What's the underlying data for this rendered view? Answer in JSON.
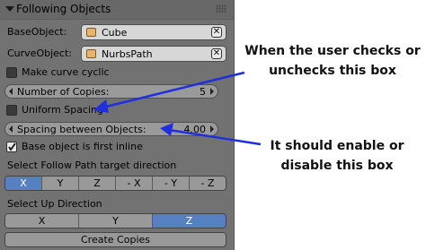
{
  "panel": {
    "title": "Following Objects",
    "base_object": {
      "label": "BaseObject:",
      "value": "Cube"
    },
    "curve_object": {
      "label": "CurveObject:",
      "value": "NurbsPath"
    },
    "make_curve_cyclic": {
      "label": "Make curve cyclic",
      "checked": false
    },
    "number_of_copies": {
      "label": "Number of Copies:",
      "value": "5"
    },
    "uniform_spacing": {
      "label": "Uniform Spacing",
      "checked": false
    },
    "spacing_between_objects": {
      "label": "Spacing between Objects:",
      "value": "4.00"
    },
    "base_first_inline": {
      "label": "Base object is first inline",
      "checked": true
    },
    "follow_path_direction": {
      "label": "Select Follow Path target direction",
      "options": [
        "X",
        "Y",
        "Z",
        "- X",
        "- Y",
        "- Z"
      ],
      "selected": "X"
    },
    "up_direction": {
      "label": "Select Up Direction",
      "options": [
        "X",
        "Y",
        "Z"
      ],
      "selected": "Z"
    },
    "create_button": "Create Copies"
  },
  "annotations": {
    "top_line1": "When the user checks or",
    "top_line2": "unchecks this box",
    "bottom_line1": "It should enable or",
    "bottom_line2": "disable this box"
  },
  "arrow_color": "#1f2fe0"
}
